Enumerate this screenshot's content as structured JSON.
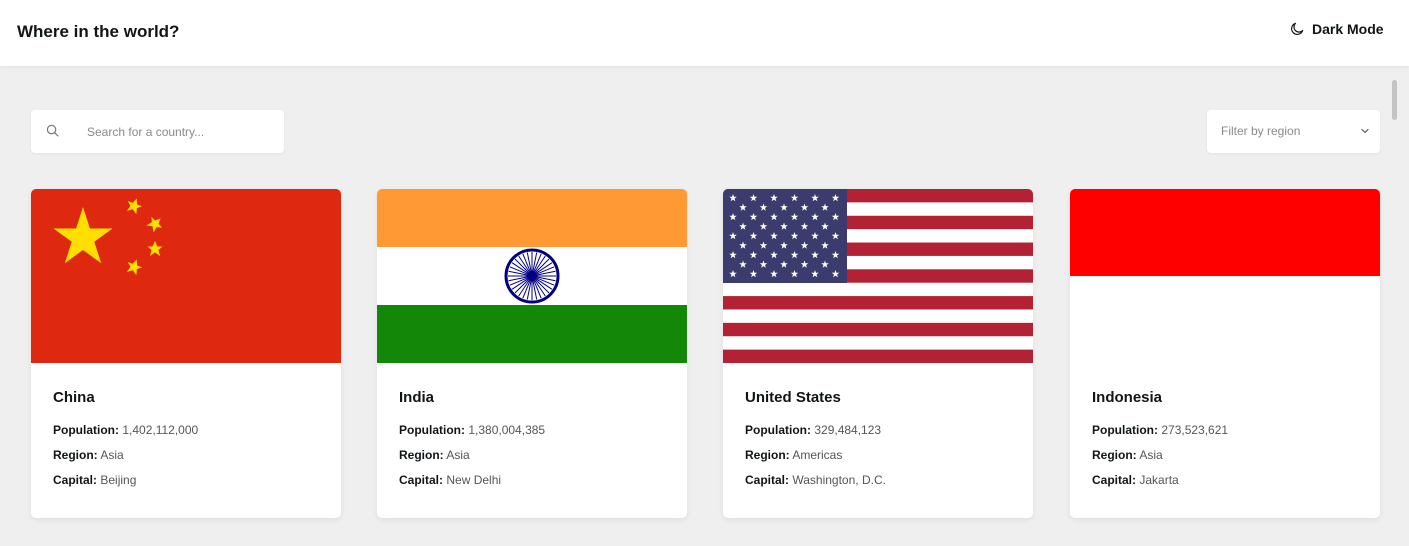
{
  "header": {
    "title": "Where in the world?",
    "dark_mode_label": "Dark Mode",
    "dark_mode_icon": "moon-icon"
  },
  "search": {
    "placeholder": "Search for a country...",
    "value": "",
    "icon": "search-icon"
  },
  "filter": {
    "label": "Filter by region",
    "icon": "chevron-down-icon"
  },
  "labels": {
    "population": "Population:",
    "region": "Region:",
    "capital": "Capital:"
  },
  "countries": [
    {
      "name": "China",
      "population": "1,402,112,000",
      "region": "Asia",
      "capital": "Beijing",
      "flag": "china-flag"
    },
    {
      "name": "India",
      "population": "1,380,004,385",
      "region": "Asia",
      "capital": "New Delhi",
      "flag": "india-flag"
    },
    {
      "name": "United States",
      "population": "329,484,123",
      "region": "Americas",
      "capital": "Washington, D.C.",
      "flag": "usa-flag"
    },
    {
      "name": "Indonesia",
      "population": "273,523,621",
      "region": "Asia",
      "capital": "Jakarta",
      "flag": "indonesia-flag"
    }
  ],
  "colors": {
    "background": "#efefef",
    "surface": "#ffffff",
    "text": "#111517",
    "china_red": "#de2910",
    "china_yellow": "#ffde00",
    "india_saffron": "#ff9933",
    "india_green": "#138808",
    "india_navy": "#000080",
    "usa_red": "#b22234",
    "usa_blue": "#3c3b6e",
    "indonesia_red": "#ff0000"
  }
}
